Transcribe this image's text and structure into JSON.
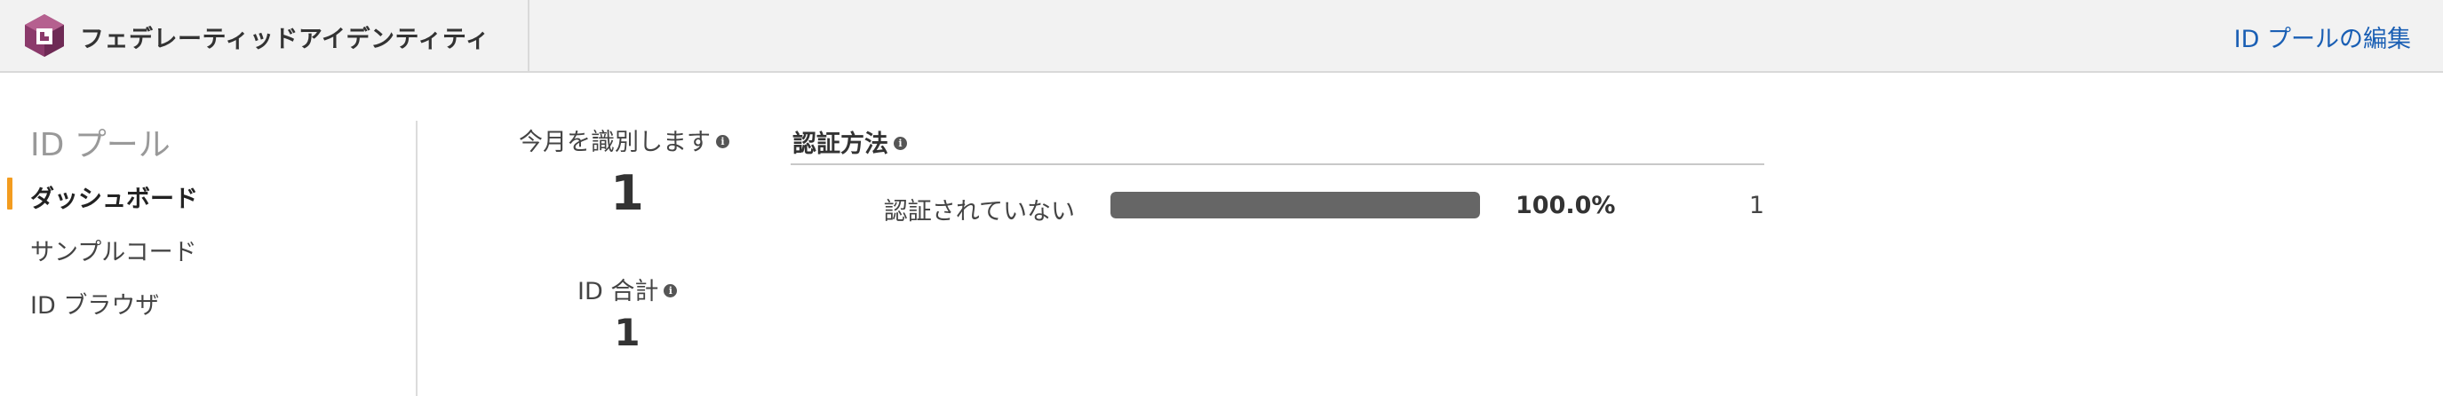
{
  "header": {
    "app_title": "フェデレーティッドアイデンティティ",
    "edit_link": "ID プールの編集",
    "logo_icon": "cognito-logo-icon"
  },
  "sidebar": {
    "title": "ID プール",
    "items": [
      {
        "label": "ダッシュボード",
        "active": true
      },
      {
        "label": "サンプルコード",
        "active": false
      },
      {
        "label": "ID ブラウザ",
        "active": false
      }
    ],
    "active_color": "#f39c1f"
  },
  "stats": {
    "monthly": {
      "label": "今月を識別します",
      "value": "1"
    },
    "total": {
      "label": "ID 合計",
      "value": "1"
    },
    "info_icon": "info-icon"
  },
  "auth_methods": {
    "title": "認証方法",
    "rows": [
      {
        "label": "認証されていない",
        "fraction": 1.0,
        "percent_text": "100.0%",
        "count": "1"
      }
    ],
    "bar_color": "#666666"
  },
  "colors": {
    "link": "#1a5fb4",
    "header_bg": "#f2f2f2",
    "logo_primary": "#8b3a6b"
  }
}
